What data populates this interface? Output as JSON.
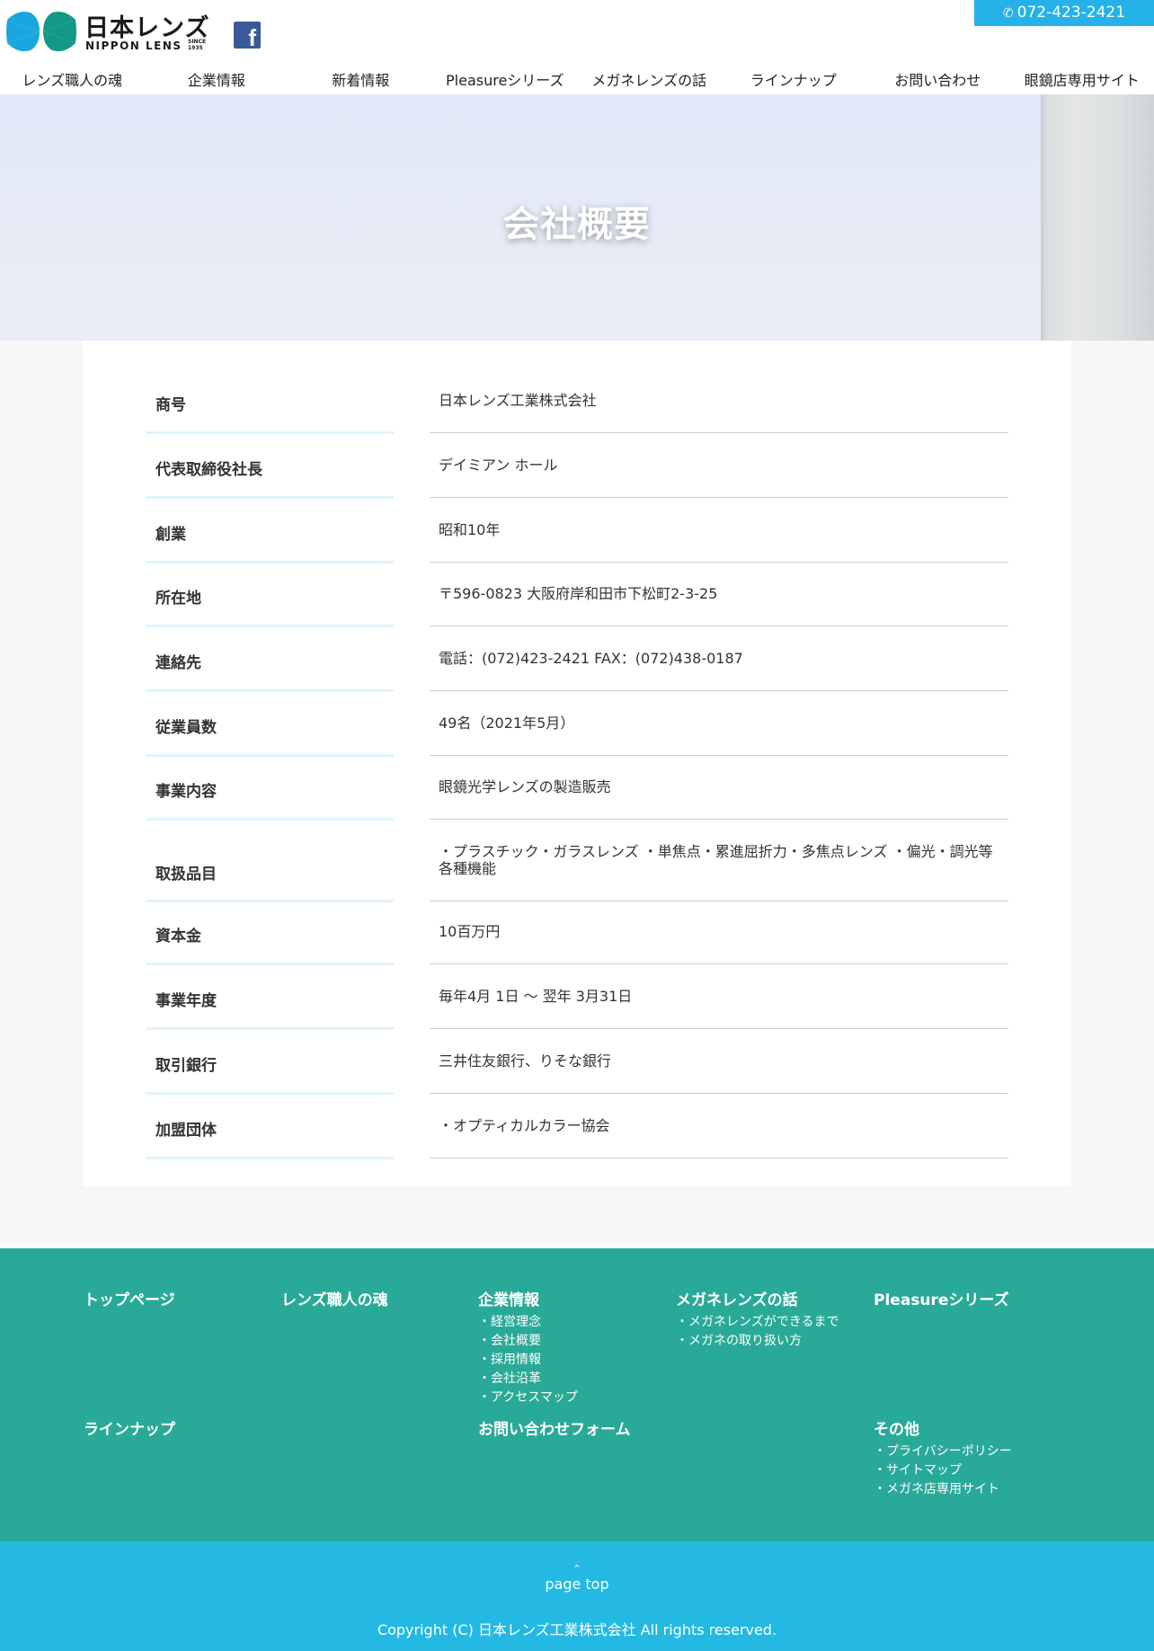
{
  "header": {
    "logo_jp": "日本レンズ",
    "logo_en": "NIPPON LENS",
    "logo_since": "SINCE 1935",
    "facebook_icon": "facebook-icon",
    "tel": "072-423-2421",
    "tel_icon": "phone-icon"
  },
  "nav": {
    "items": [
      {
        "label": "レンズ職人の魂"
      },
      {
        "label": "企業情報"
      },
      {
        "label": "新着情報"
      },
      {
        "label": "Pleasureシリーズ"
      },
      {
        "label": "メガネレンズの話"
      },
      {
        "label": "ラインナップ"
      },
      {
        "label": "お問い合わせ"
      },
      {
        "label": "眼鏡店専用サイト"
      }
    ]
  },
  "hero": {
    "title": "会社概要"
  },
  "company": {
    "rows": [
      {
        "label": "商号",
        "value": "日本レンズ工業株式会社"
      },
      {
        "label": "代表取締役社長",
        "value": "デイミアン ホール"
      },
      {
        "label": "創業",
        "value": "昭和10年"
      },
      {
        "label": "所在地",
        "value": "〒596-0823 大阪府岸和田市下松町2-3-25"
      },
      {
        "label": "連絡先",
        "value": "電話：(072)423-2421 FAX：(072)438-0187"
      },
      {
        "label": "従業員数",
        "value": "49名（2021年5月）"
      },
      {
        "label": "事業内容",
        "value": "眼鏡光学レンズの製造販売"
      },
      {
        "label": "取扱品目",
        "value": "・プラスチック・ガラスレンズ ・単焦点・累進屈折力・多焦点レンズ ・偏光・調光等各種機能"
      },
      {
        "label": "資本金",
        "value": "10百万円"
      },
      {
        "label": "事業年度",
        "value": "毎年4月 1日 〜 翌年 3月31日"
      },
      {
        "label": "取引銀行",
        "value": "三井住友銀行、りそな銀行"
      },
      {
        "label": "加盟団体",
        "value": "・オプティカルカラー協会"
      }
    ]
  },
  "footer": {
    "top_page": "トップページ",
    "craftsman": "レンズ職人の魂",
    "company_info": {
      "heading": "企業情報",
      "links": [
        "・経営理念",
        "・会社概要",
        "・採用情報",
        "・会社沿革",
        "・アクセスマップ"
      ]
    },
    "lens_story": {
      "heading": "メガネレンズの話",
      "links": [
        "・メガネレンズができるまで",
        "・メガネの取り扱い方"
      ]
    },
    "pleasure": "Pleasureシリーズ",
    "lineup": "ラインナップ",
    "contact_form": "お問い合わせフォーム",
    "other": {
      "heading": "その他",
      "links": [
        "・プライバシーポリシー",
        "・サイトマップ",
        "・メガネ店専用サイト"
      ]
    }
  },
  "bottom": {
    "page_top_icon": "chevron-up-icon",
    "page_top_label": "page top",
    "copyright": "Copyright (C) 日本レンズ工業株式会社 All rights reserved."
  },
  "colors": {
    "accent_blue": "#24b2e9",
    "footer_green": "#29aa98",
    "logo_blue": "#1aa7e0",
    "logo_green": "#129a86"
  }
}
